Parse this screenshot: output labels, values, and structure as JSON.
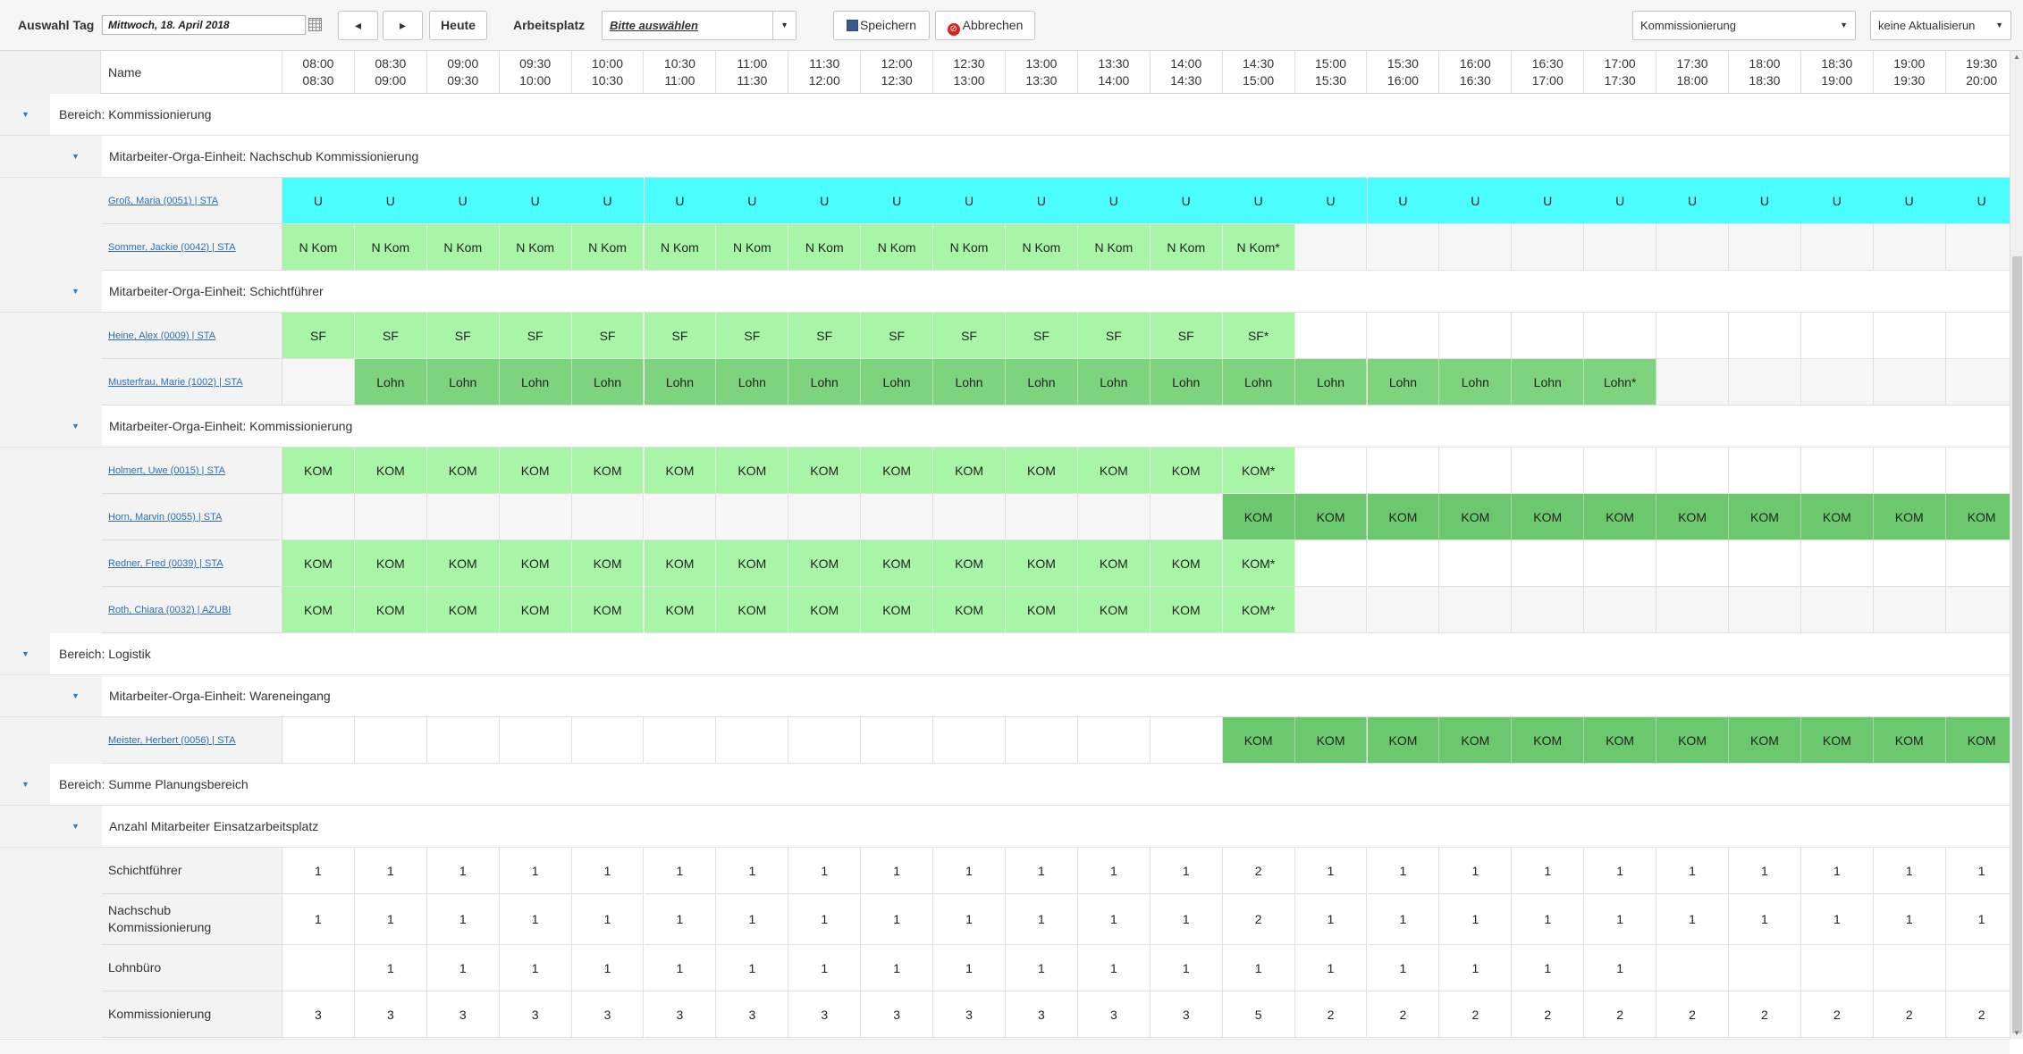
{
  "toolbar": {
    "day_label": "Auswahl Tag",
    "date_value": "Mittwoch, 18. April 2018",
    "prev_icon": "caret-left-icon",
    "next_icon": "caret-right-icon",
    "today_label": "Heute",
    "workplace_label": "Arbeitsplatz",
    "workplace_value": "Bitte auswählen",
    "save_label": "Speichern",
    "cancel_label": "Abbrechen",
    "area_select": "Kommissionierung",
    "refresh_select": "keine Aktualisierun"
  },
  "header": {
    "name_col": "Name",
    "slots": [
      [
        "08:00",
        "08:30"
      ],
      [
        "08:30",
        "09:00"
      ],
      [
        "09:00",
        "09:30"
      ],
      [
        "09:30",
        "10:00"
      ],
      [
        "10:00",
        "10:30"
      ],
      [
        "10:30",
        "11:00"
      ],
      [
        "11:00",
        "11:30"
      ],
      [
        "11:30",
        "12:00"
      ],
      [
        "12:00",
        "12:30"
      ],
      [
        "12:30",
        "13:00"
      ],
      [
        "13:00",
        "13:30"
      ],
      [
        "13:30",
        "14:00"
      ],
      [
        "14:00",
        "14:30"
      ],
      [
        "14:30",
        "15:00"
      ],
      [
        "15:00",
        "15:30"
      ],
      [
        "15:30",
        "16:00"
      ],
      [
        "16:00",
        "16:30"
      ],
      [
        "16:30",
        "17:00"
      ],
      [
        "17:00",
        "17:30"
      ],
      [
        "17:30",
        "18:00"
      ],
      [
        "18:00",
        "18:30"
      ],
      [
        "18:30",
        "19:00"
      ],
      [
        "19:00",
        "19:30"
      ],
      [
        "19:30",
        "20:00"
      ]
    ]
  },
  "colors": {
    "vacation": "#4cfdfd",
    "light_green": "#a9f5a7",
    "medium_green": "#7ed37e",
    "dark_green": "#6cc86e",
    "link": "#2a6fb5"
  },
  "rows": [
    {
      "type": "area",
      "label": "Bereich: Kommissionierung"
    },
    {
      "type": "unit",
      "label": "Mitarbeiter-Orga-Einheit: Nachschub Kommissionierung"
    },
    {
      "type": "emp",
      "name": "Groß, Maria (0051) | STA",
      "cells": [
        "U",
        "U",
        "U",
        "U",
        "U",
        "U",
        "U",
        "U",
        "U",
        "U",
        "U",
        "U",
        "U",
        "U",
        "U",
        "U",
        "U",
        "U",
        "U",
        "U",
        "U",
        "U",
        "U",
        "U"
      ],
      "styles": [
        "U",
        "U",
        "U",
        "U",
        "U",
        "U",
        "U",
        "U",
        "U",
        "U",
        "U",
        "U",
        "U",
        "U",
        "U",
        "U",
        "U",
        "U",
        "U",
        "U",
        "U",
        "U",
        "U",
        "U"
      ]
    },
    {
      "type": "emp",
      "name": "Sommer, Jackie (0042) | STA",
      "cells": [
        "N Kom",
        "N Kom",
        "N Kom",
        "N Kom",
        "N Kom",
        "N Kom",
        "N Kom",
        "N Kom",
        "N Kom",
        "N Kom",
        "N Kom",
        "N Kom",
        "N Kom",
        "N Kom*",
        "",
        "",
        "",
        "",
        "",
        "",
        "",
        "",
        "",
        ""
      ],
      "styles": [
        "lg",
        "lg",
        "lg",
        "lg",
        "lg",
        "lg",
        "lg",
        "lg",
        "lg",
        "lg",
        "lg",
        "lg",
        "lg",
        "lg",
        "grey",
        "grey",
        "grey",
        "grey",
        "grey",
        "grey",
        "grey",
        "grey",
        "grey",
        "grey"
      ]
    },
    {
      "type": "unit",
      "label": "Mitarbeiter-Orga-Einheit: Schichtführer"
    },
    {
      "type": "emp",
      "name": "Heine, Alex (0009) | STA",
      "cells": [
        "SF",
        "SF",
        "SF",
        "SF",
        "SF",
        "SF",
        "SF",
        "SF",
        "SF",
        "SF",
        "SF",
        "SF",
        "SF",
        "SF*",
        "",
        "",
        "",
        "",
        "",
        "",
        "",
        "",
        "",
        ""
      ],
      "styles": [
        "lg",
        "lg",
        "lg",
        "lg",
        "lg",
        "lg",
        "lg",
        "lg",
        "lg",
        "lg",
        "lg",
        "lg",
        "lg",
        "lg",
        "white",
        "white",
        "white",
        "white",
        "white",
        "white",
        "white",
        "white",
        "white",
        "white"
      ]
    },
    {
      "type": "emp",
      "name": "Musterfrau, Marie (1002) | STA",
      "cells": [
        "",
        "Lohn",
        "Lohn",
        "Lohn",
        "Lohn",
        "Lohn",
        "Lohn",
        "Lohn",
        "Lohn",
        "Lohn",
        "Lohn",
        "Lohn",
        "Lohn",
        "Lohn",
        "Lohn",
        "Lohn",
        "Lohn",
        "Lohn",
        "Lohn*",
        "",
        "",
        "",
        "",
        ""
      ],
      "styles": [
        "grey",
        "md",
        "md",
        "md",
        "md",
        "md",
        "md",
        "md",
        "md",
        "md",
        "md",
        "md",
        "md",
        "md",
        "md",
        "md",
        "md",
        "md",
        "md",
        "grey",
        "grey",
        "grey",
        "grey",
        "grey"
      ]
    },
    {
      "type": "unit",
      "label": "Mitarbeiter-Orga-Einheit: Kommissionierung"
    },
    {
      "type": "emp",
      "name": "Holmert, Uwe (0015) | STA",
      "cells": [
        "KOM",
        "KOM",
        "KOM",
        "KOM",
        "KOM",
        "KOM",
        "KOM",
        "KOM",
        "KOM",
        "KOM",
        "KOM",
        "KOM",
        "KOM",
        "KOM*",
        "",
        "",
        "",
        "",
        "",
        "",
        "",
        "",
        "",
        ""
      ],
      "styles": [
        "lg",
        "lg",
        "lg",
        "lg",
        "lg",
        "lg",
        "lg",
        "lg",
        "lg",
        "lg",
        "lg",
        "lg",
        "lg",
        "lg",
        "white",
        "white",
        "white",
        "white",
        "white",
        "white",
        "white",
        "white",
        "white",
        "white"
      ]
    },
    {
      "type": "emp",
      "name": "Horn, Marvin (0055) | STA",
      "cells": [
        "",
        "",
        "",
        "",
        "",
        "",
        "",
        "",
        "",
        "",
        "",
        "",
        "",
        "KOM",
        "KOM",
        "KOM",
        "KOM",
        "KOM",
        "KOM",
        "KOM",
        "KOM",
        "KOM",
        "KOM",
        "KOM"
      ],
      "styles": [
        "grey",
        "grey",
        "grey",
        "grey",
        "grey",
        "grey",
        "grey",
        "grey",
        "grey",
        "grey",
        "grey",
        "grey",
        "grey",
        "dk",
        "dk",
        "dk",
        "dk",
        "dk",
        "dk",
        "dk",
        "dk",
        "dk",
        "dk",
        "dk"
      ]
    },
    {
      "type": "emp",
      "name": "Redner, Fred (0039) | STA",
      "cells": [
        "KOM",
        "KOM",
        "KOM",
        "KOM",
        "KOM",
        "KOM",
        "KOM",
        "KOM",
        "KOM",
        "KOM",
        "KOM",
        "KOM",
        "KOM",
        "KOM*",
        "",
        "",
        "",
        "",
        "",
        "",
        "",
        "",
        "",
        ""
      ],
      "styles": [
        "lg",
        "lg",
        "lg",
        "lg",
        "lg",
        "lg",
        "lg",
        "lg",
        "lg",
        "lg",
        "lg",
        "lg",
        "lg",
        "lg",
        "white",
        "white",
        "white",
        "white",
        "white",
        "white",
        "white",
        "white",
        "white",
        "white"
      ]
    },
    {
      "type": "emp",
      "name": "Roth, Chiara (0032) | AZUBI",
      "cells": [
        "KOM",
        "KOM",
        "KOM",
        "KOM",
        "KOM",
        "KOM",
        "KOM",
        "KOM",
        "KOM",
        "KOM",
        "KOM",
        "KOM",
        "KOM",
        "KOM*",
        "",
        "",
        "",
        "",
        "",
        "",
        "",
        "",
        "",
        ""
      ],
      "styles": [
        "lg",
        "lg",
        "lg",
        "lg",
        "lg",
        "lg",
        "lg",
        "lg",
        "lg",
        "lg",
        "lg",
        "lg",
        "lg",
        "lg",
        "grey",
        "grey",
        "grey",
        "grey",
        "grey",
        "grey",
        "grey",
        "grey",
        "grey",
        "grey"
      ]
    },
    {
      "type": "area",
      "label": "Bereich: Logistik"
    },
    {
      "type": "unit",
      "label": "Mitarbeiter-Orga-Einheit: Wareneingang"
    },
    {
      "type": "emp",
      "name": "Meister, Herbert (0056) | STA",
      "cells": [
        "",
        "",
        "",
        "",
        "",
        "",
        "",
        "",
        "",
        "",
        "",
        "",
        "",
        "KOM",
        "KOM",
        "KOM",
        "KOM",
        "KOM",
        "KOM",
        "KOM",
        "KOM",
        "KOM",
        "KOM",
        "KOM"
      ],
      "styles": [
        "white",
        "white",
        "white",
        "white",
        "white",
        "white",
        "white",
        "white",
        "white",
        "white",
        "white",
        "white",
        "white",
        "dk",
        "dk",
        "dk",
        "dk",
        "dk",
        "dk",
        "dk",
        "dk",
        "dk",
        "dk",
        "dk"
      ]
    },
    {
      "type": "area",
      "label": "Bereich: Summe Planungsbereich"
    },
    {
      "type": "unit",
      "label": "Anzahl Mitarbeiter Einsatzarbeitsplatz"
    },
    {
      "type": "sum",
      "name": "Schichtführer",
      "cells": [
        "1",
        "1",
        "1",
        "1",
        "1",
        "1",
        "1",
        "1",
        "1",
        "1",
        "1",
        "1",
        "1",
        "2",
        "1",
        "1",
        "1",
        "1",
        "1",
        "1",
        "1",
        "1",
        "1",
        "1"
      ]
    },
    {
      "type": "sum",
      "name": "Nachschub Kommissionierung",
      "cells": [
        "1",
        "1",
        "1",
        "1",
        "1",
        "1",
        "1",
        "1",
        "1",
        "1",
        "1",
        "1",
        "1",
        "2",
        "1",
        "1",
        "1",
        "1",
        "1",
        "1",
        "1",
        "1",
        "1",
        "1"
      ]
    },
    {
      "type": "sum",
      "name": "Lohnbüro",
      "cells": [
        "",
        "1",
        "1",
        "1",
        "1",
        "1",
        "1",
        "1",
        "1",
        "1",
        "1",
        "1",
        "1",
        "1",
        "1",
        "1",
        "1",
        "1",
        "1",
        "",
        "",
        "",
        "",
        ""
      ]
    },
    {
      "type": "sum",
      "name": "Kommissionierung",
      "cells": [
        "3",
        "3",
        "3",
        "3",
        "3",
        "3",
        "3",
        "3",
        "3",
        "3",
        "3",
        "3",
        "3",
        "5",
        "2",
        "2",
        "2",
        "2",
        "2",
        "2",
        "2",
        "2",
        "2",
        "2"
      ]
    }
  ]
}
